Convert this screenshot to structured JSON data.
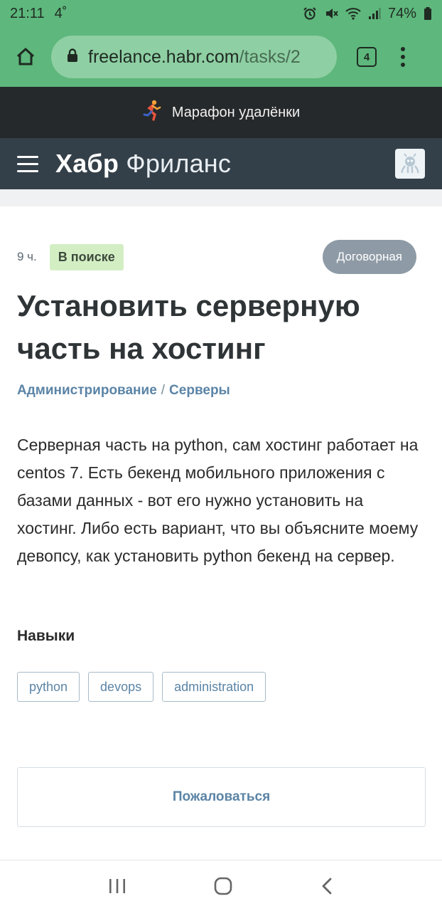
{
  "status_bar": {
    "time": "21:11",
    "temperature": "4˚",
    "battery": "74%"
  },
  "browser": {
    "url_domain": "freelance.habr.com",
    "url_path": "/tasks/2",
    "tab_count": "4"
  },
  "banner": {
    "text": "Марафон удалёнки"
  },
  "header": {
    "logo_bold": "Хабр",
    "logo_light": "Фриланс"
  },
  "task": {
    "time_ago": "9 ч.",
    "status": "В поиске",
    "price": "Договорная",
    "title": "Установить серверную часть на хостинг",
    "breadcrumb": [
      "Администрирование",
      "Серверы"
    ],
    "breadcrumb_separator": "/",
    "description": "Серверная часть на python, сам хостинг работает на centos 7. Есть бекенд мобильного приложения с базами данных - вот его нужно установить на хостинг. Либо есть вариант, что вы объясните моему девопсу, как установить python бекенд на сервер.",
    "skills_title": "Навыки",
    "tags": [
      "python",
      "devops",
      "administration"
    ],
    "report_label": "Пожаловаться"
  },
  "colors": {
    "browser_green": "#5eb77c",
    "header_dark": "#344049",
    "banner_dark": "#26292b",
    "link_blue": "#5b84a6",
    "status_green_bg": "#d4eec4",
    "price_gray": "#8e9ba6"
  },
  "icons": {
    "status_bar": [
      "alarm-icon",
      "mute-icon",
      "wifi-icon",
      "signal-icon",
      "battery-icon"
    ],
    "nav": [
      "recent-apps-icon",
      "home-nav-icon",
      "back-icon"
    ]
  }
}
